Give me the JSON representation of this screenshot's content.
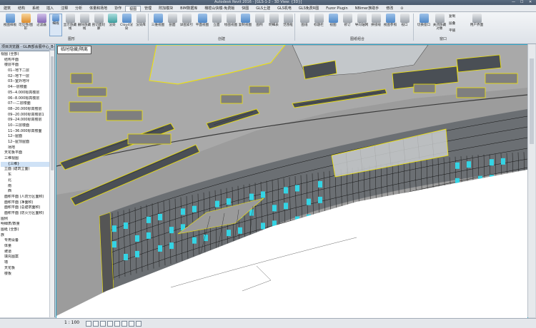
{
  "window": {
    "title": "Autodesk Revit 2016 - [GLS-1-2 - 3D View: {3D}]",
    "controls": [
      "—",
      "☐",
      "✕"
    ]
  },
  "menu": {
    "items": [
      "建筑",
      "结构",
      "系统",
      "插入",
      "注释",
      "分析",
      "体量和场地",
      "协作",
      "视图",
      "管理",
      "附加模块",
      "BIM数据库",
      "橄榄山快模-免费版",
      "快图",
      "GLS土建",
      "GLS机电",
      "GLS免费R图",
      "Fuzor Plugin",
      "NBimer族助手",
      "修改",
      "⊙"
    ],
    "active_index": 8
  },
  "ribbon": {
    "panel_titles": [
      "图形",
      "创建",
      "图纸组合",
      "窗口"
    ],
    "graphics": [
      "视图样板",
      "可见性/图形",
      "过滤器",
      "细线",
      "显示隐藏线",
      "删除隐藏线",
      "剖切面轮廓",
      "渲染",
      "Cloud渲染",
      "渲染库"
    ],
    "create": [
      "三维视图",
      "剖面",
      "详图索引",
      "平面视图",
      "立面",
      "绘图视图",
      "复制视图",
      "图例",
      "明细表",
      "范围框"
    ],
    "sheet": [
      "图纸",
      "标题栏",
      "视图",
      "修订",
      "导向轴网",
      "拼接线",
      "视图参照",
      "视口"
    ],
    "window": [
      "切换窗口",
      "关闭隐藏对象",
      "复制",
      "层叠",
      "平铺",
      "用户界面"
    ]
  },
  "browser": {
    "header": "项目浏览器 - GL西部会展中心_B-...",
    "nodes": [
      {
        "label": "视图 (全部)",
        "indent": 0
      },
      {
        "label": "结构平面",
        "indent": 1
      },
      {
        "label": "楼层平面",
        "indent": 1
      },
      {
        "label": "01--地下二层",
        "indent": 2
      },
      {
        "label": "02--地下一层",
        "indent": 2
      },
      {
        "label": "03--室外地坪",
        "indent": 2
      },
      {
        "label": "04---层楼面",
        "indent": 2
      },
      {
        "label": "05--4.000标高楼层",
        "indent": 2
      },
      {
        "label": "06--8.000标高楼层",
        "indent": 2
      },
      {
        "label": "07---二层楼面",
        "indent": 2
      },
      {
        "label": "08--20.000标高楼层",
        "indent": 2
      },
      {
        "label": "09--20.000标高楼层1",
        "indent": 2
      },
      {
        "label": "09--24.000标高楼层",
        "indent": 2
      },
      {
        "label": "10--三层楼面",
        "indent": 2
      },
      {
        "label": "11--36.000标高楼面",
        "indent": 2
      },
      {
        "label": "12--屋面",
        "indent": 2
      },
      {
        "label": "12--屋顶屋面",
        "indent": 2
      },
      {
        "label": "场地",
        "indent": 2
      },
      {
        "label": "天花板平面",
        "indent": 1
      },
      {
        "label": "三维视图",
        "indent": 1
      },
      {
        "label": "{三维}",
        "indent": 2
      },
      {
        "label": "立面 (建筑立面)",
        "indent": 1
      },
      {
        "label": "东",
        "indent": 2
      },
      {
        "label": "北",
        "indent": 2
      },
      {
        "label": "南",
        "indent": 2
      },
      {
        "label": "西",
        "indent": 2
      },
      {
        "label": "面积平面 (人防分区面积)",
        "indent": 1
      },
      {
        "label": "面积平面 (净面积)",
        "indent": 1
      },
      {
        "label": "面积平面 (总建筑面积)",
        "indent": 1
      },
      {
        "label": "面积平面 (防火分区面积)",
        "indent": 1
      },
      {
        "label": "图例",
        "indent": 0
      },
      {
        "label": "明细表/数量",
        "indent": 0
      },
      {
        "label": "图纸 (全部)",
        "indent": 0
      },
      {
        "label": "族",
        "indent": 0
      },
      {
        "label": "专用设备",
        "indent": 1
      },
      {
        "label": "体量",
        "indent": 1
      },
      {
        "label": "坡道",
        "indent": 1
      },
      {
        "label": "填充图案",
        "indent": 1
      },
      {
        "label": "墙",
        "indent": 1
      },
      {
        "label": "天花板",
        "indent": 1
      },
      {
        "label": "楼板",
        "indent": 1
      }
    ],
    "selected_index": 20
  },
  "viewport": {
    "tab_label": "临时隐藏/隔离"
  },
  "status": {
    "scale": "1 : 100"
  },
  "colors": {
    "accent": "#2ea6c8",
    "highlight_yellow": "#f2e400",
    "glass_cyan": "#34d4e4",
    "model_gray": "#8e8e8e"
  }
}
